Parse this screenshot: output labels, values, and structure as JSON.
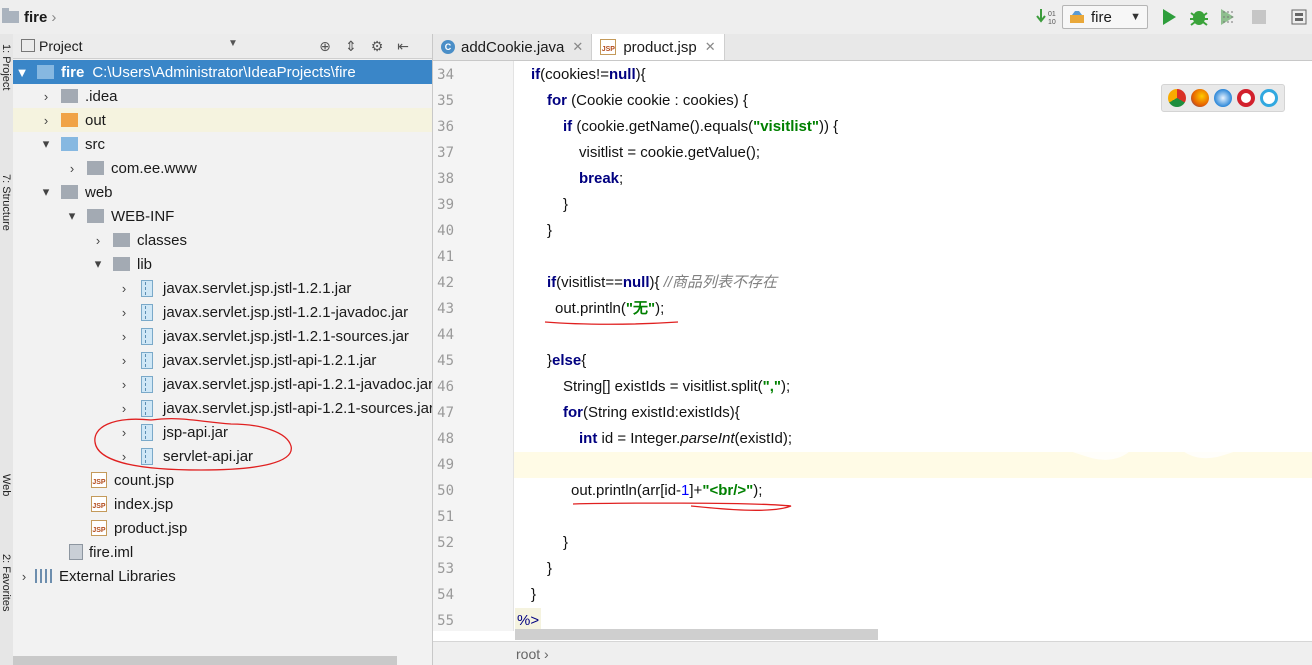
{
  "toolbar": {
    "project_name": "fire",
    "run_config": "fire"
  },
  "side_tabs": {
    "project": "1: Project",
    "structure": "7: Structure",
    "web": "Web",
    "favorites": "2: Favorites"
  },
  "project_panel": {
    "title": "Project",
    "tree": [
      {
        "label": "fire",
        "path": "C:\\Users\\Administrator\\IdeaProjects\\fire"
      },
      {
        "label": ".idea"
      },
      {
        "label": "out"
      },
      {
        "label": "src"
      },
      {
        "label": "com.ee.www"
      },
      {
        "label": "web"
      },
      {
        "label": "WEB-INF"
      },
      {
        "label": "classes"
      },
      {
        "label": "lib"
      },
      {
        "label": "javax.servlet.jsp.jstl-1.2.1.jar"
      },
      {
        "label": "javax.servlet.jsp.jstl-1.2.1-javadoc.jar"
      },
      {
        "label": "javax.servlet.jsp.jstl-1.2.1-sources.jar"
      },
      {
        "label": "javax.servlet.jsp.jstl-api-1.2.1.jar"
      },
      {
        "label": "javax.servlet.jsp.jstl-api-1.2.1-javadoc.jar"
      },
      {
        "label": "javax.servlet.jsp.jstl-api-1.2.1-sources.jar"
      },
      {
        "label": "jsp-api.jar"
      },
      {
        "label": "servlet-api.jar"
      },
      {
        "label": "count.jsp"
      },
      {
        "label": "index.jsp"
      },
      {
        "label": "product.jsp"
      },
      {
        "label": "fire.iml"
      },
      {
        "label": "External Libraries"
      }
    ]
  },
  "editor": {
    "tabs": [
      {
        "label": "addCookie.java"
      },
      {
        "label": "product.jsp"
      }
    ],
    "line_numbers": [
      "34",
      "35",
      "36",
      "37",
      "38",
      "39",
      "40",
      "41",
      "42",
      "43",
      "44",
      "45",
      "46",
      "47",
      "48",
      "49",
      "50",
      "51",
      "52",
      "53",
      "54",
      "55"
    ],
    "code": {
      "l34": [
        "if",
        "(cookies!=",
        "null",
        "){"
      ],
      "l35": [
        "for",
        " (Cookie cookie : cookies) {"
      ],
      "l36": [
        "if",
        " (cookie.getName().equals(",
        "\"visitlist\"",
        ")) {"
      ],
      "l37": [
        "visitlist = cookie.getValue();"
      ],
      "l38": [
        "break",
        ";"
      ],
      "l39": [
        "}"
      ],
      "l40": [
        "}"
      ],
      "l42": [
        "if",
        "(visitlist==",
        "null",
        "){ ",
        "//商品列表不存在"
      ],
      "l43": [
        "out.println(",
        "\"无\"",
        ");"
      ],
      "l45": [
        "}",
        "else",
        "{"
      ],
      "l46": [
        "String[] existIds = visitlist.split(",
        "\",\"",
        ");"
      ],
      "l47": [
        "for",
        "(String existId:existIds){"
      ],
      "l48": [
        "int",
        " id = Integer.",
        "parseInt",
        "(existId);"
      ],
      "l50": [
        "out.println(arr[id-",
        "1",
        "]+",
        "\"<br/>\"",
        ");"
      ],
      "l52": [
        "}"
      ],
      "l53": [
        "}"
      ],
      "l54": [
        "}"
      ],
      "l55": [
        "%>"
      ]
    },
    "breadcrumb": "root"
  }
}
